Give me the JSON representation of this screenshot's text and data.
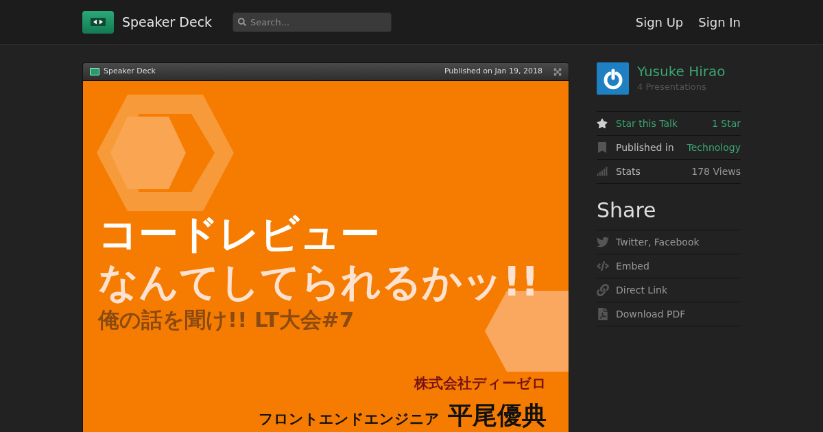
{
  "header": {
    "brand": "Speaker Deck",
    "search": {
      "placeholder": "Search..."
    },
    "nav": [
      "Sign Up",
      "Sign In"
    ]
  },
  "viewer": {
    "brand": "Speaker Deck",
    "published": "Published on Jan 19, 2018",
    "slide": {
      "title_lines": [
        "コードレビュー",
        "なんてしてられるかッ!!"
      ],
      "subtitle": "俺の話を聞け!! LT大会#7",
      "company": "株式会社ディーゼロ",
      "role": "フロントエンドエンジニア",
      "name": "平尾優典"
    }
  },
  "author": {
    "name": "Yusuke Hirao",
    "presentations": "4 Presentations"
  },
  "details": [
    {
      "kind": "star",
      "label": "Star this Talk",
      "value": "1 Star"
    },
    {
      "kind": "category",
      "label": "Published in",
      "value": "Technology"
    },
    {
      "kind": "stats",
      "label": "Stats",
      "value": "178 Views"
    }
  ],
  "share": {
    "title": "Share",
    "items": [
      {
        "kind": "social",
        "label": "Twitter, Facebook"
      },
      {
        "kind": "embed",
        "label": "Embed"
      },
      {
        "kind": "link",
        "label": "Direct Link"
      },
      {
        "kind": "pdf",
        "label": "Download PDF"
      }
    ]
  }
}
